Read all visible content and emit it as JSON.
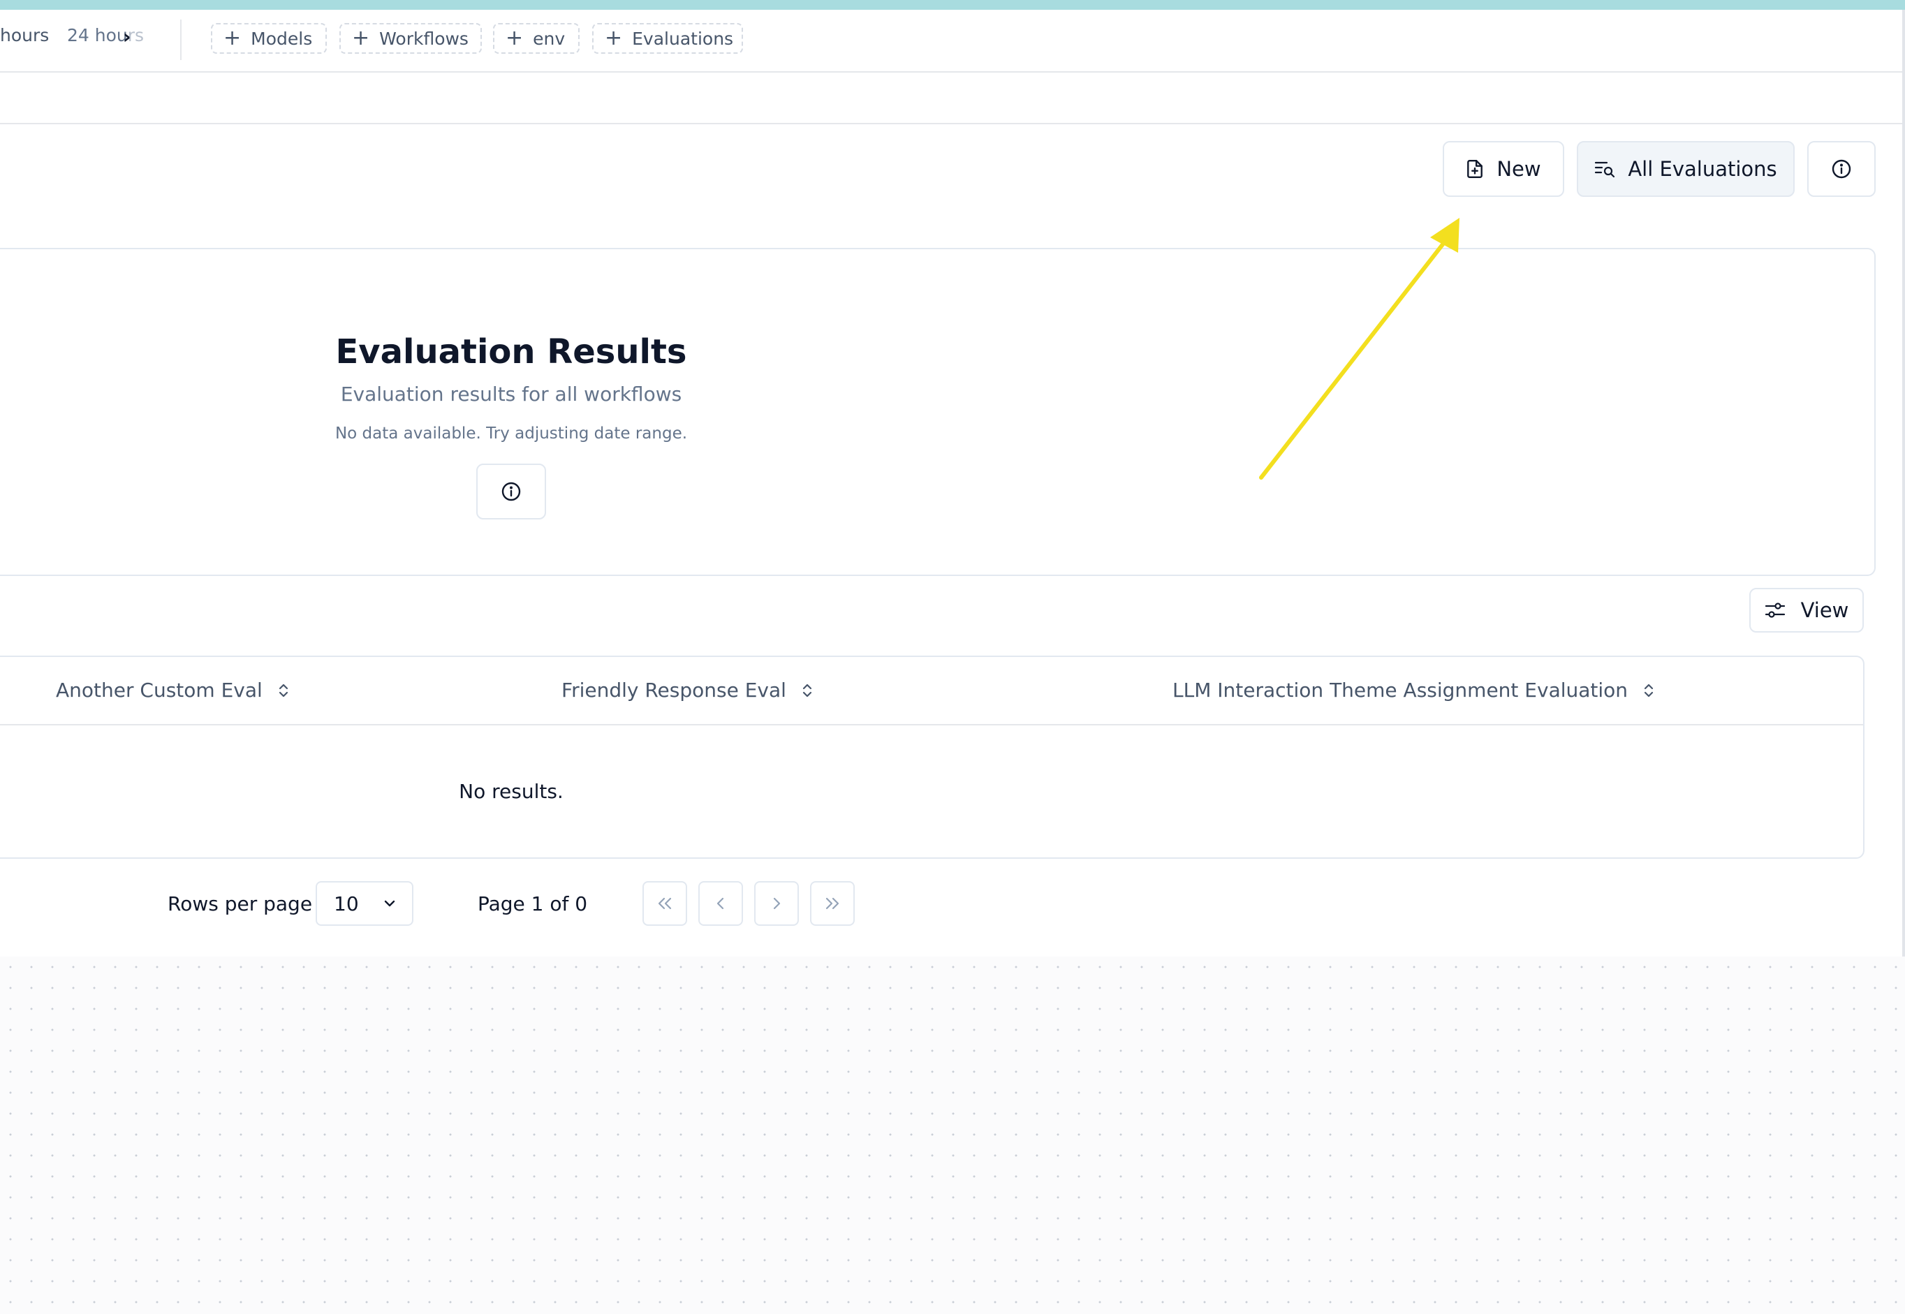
{
  "timerange": {
    "partial_label": "hours",
    "preset_number": "24",
    "preset_unit": "hou",
    "preset_unit_faded": "rs"
  },
  "filters": [
    {
      "label": "Models"
    },
    {
      "label": "Workflows"
    },
    {
      "label": "env"
    },
    {
      "label": "Evaluations"
    }
  ],
  "actions": {
    "new_label": "New",
    "all_evaluations_label": "All Evaluations"
  },
  "card": {
    "title": "Evaluation Results",
    "subtitle": "Evaluation results for all workflows",
    "empty_message": "No data available. Try adjusting date range."
  },
  "table": {
    "view_label": "View",
    "columns": [
      {
        "label": "Another Custom Eval"
      },
      {
        "label": "Friendly Response Eval"
      },
      {
        "label": "LLM Interaction Theme Assignment Evaluation"
      }
    ],
    "empty_message": "No results."
  },
  "pagination": {
    "rows_per_page_label": "Rows per page",
    "rows_per_page_value": "10",
    "page_label": "Page 1 of 0"
  },
  "colors": {
    "accent_strip": "#a8dcdf",
    "annotation_arrow": "#f3df1f",
    "border": "#e2e8f0",
    "muted_text": "#64748b"
  }
}
